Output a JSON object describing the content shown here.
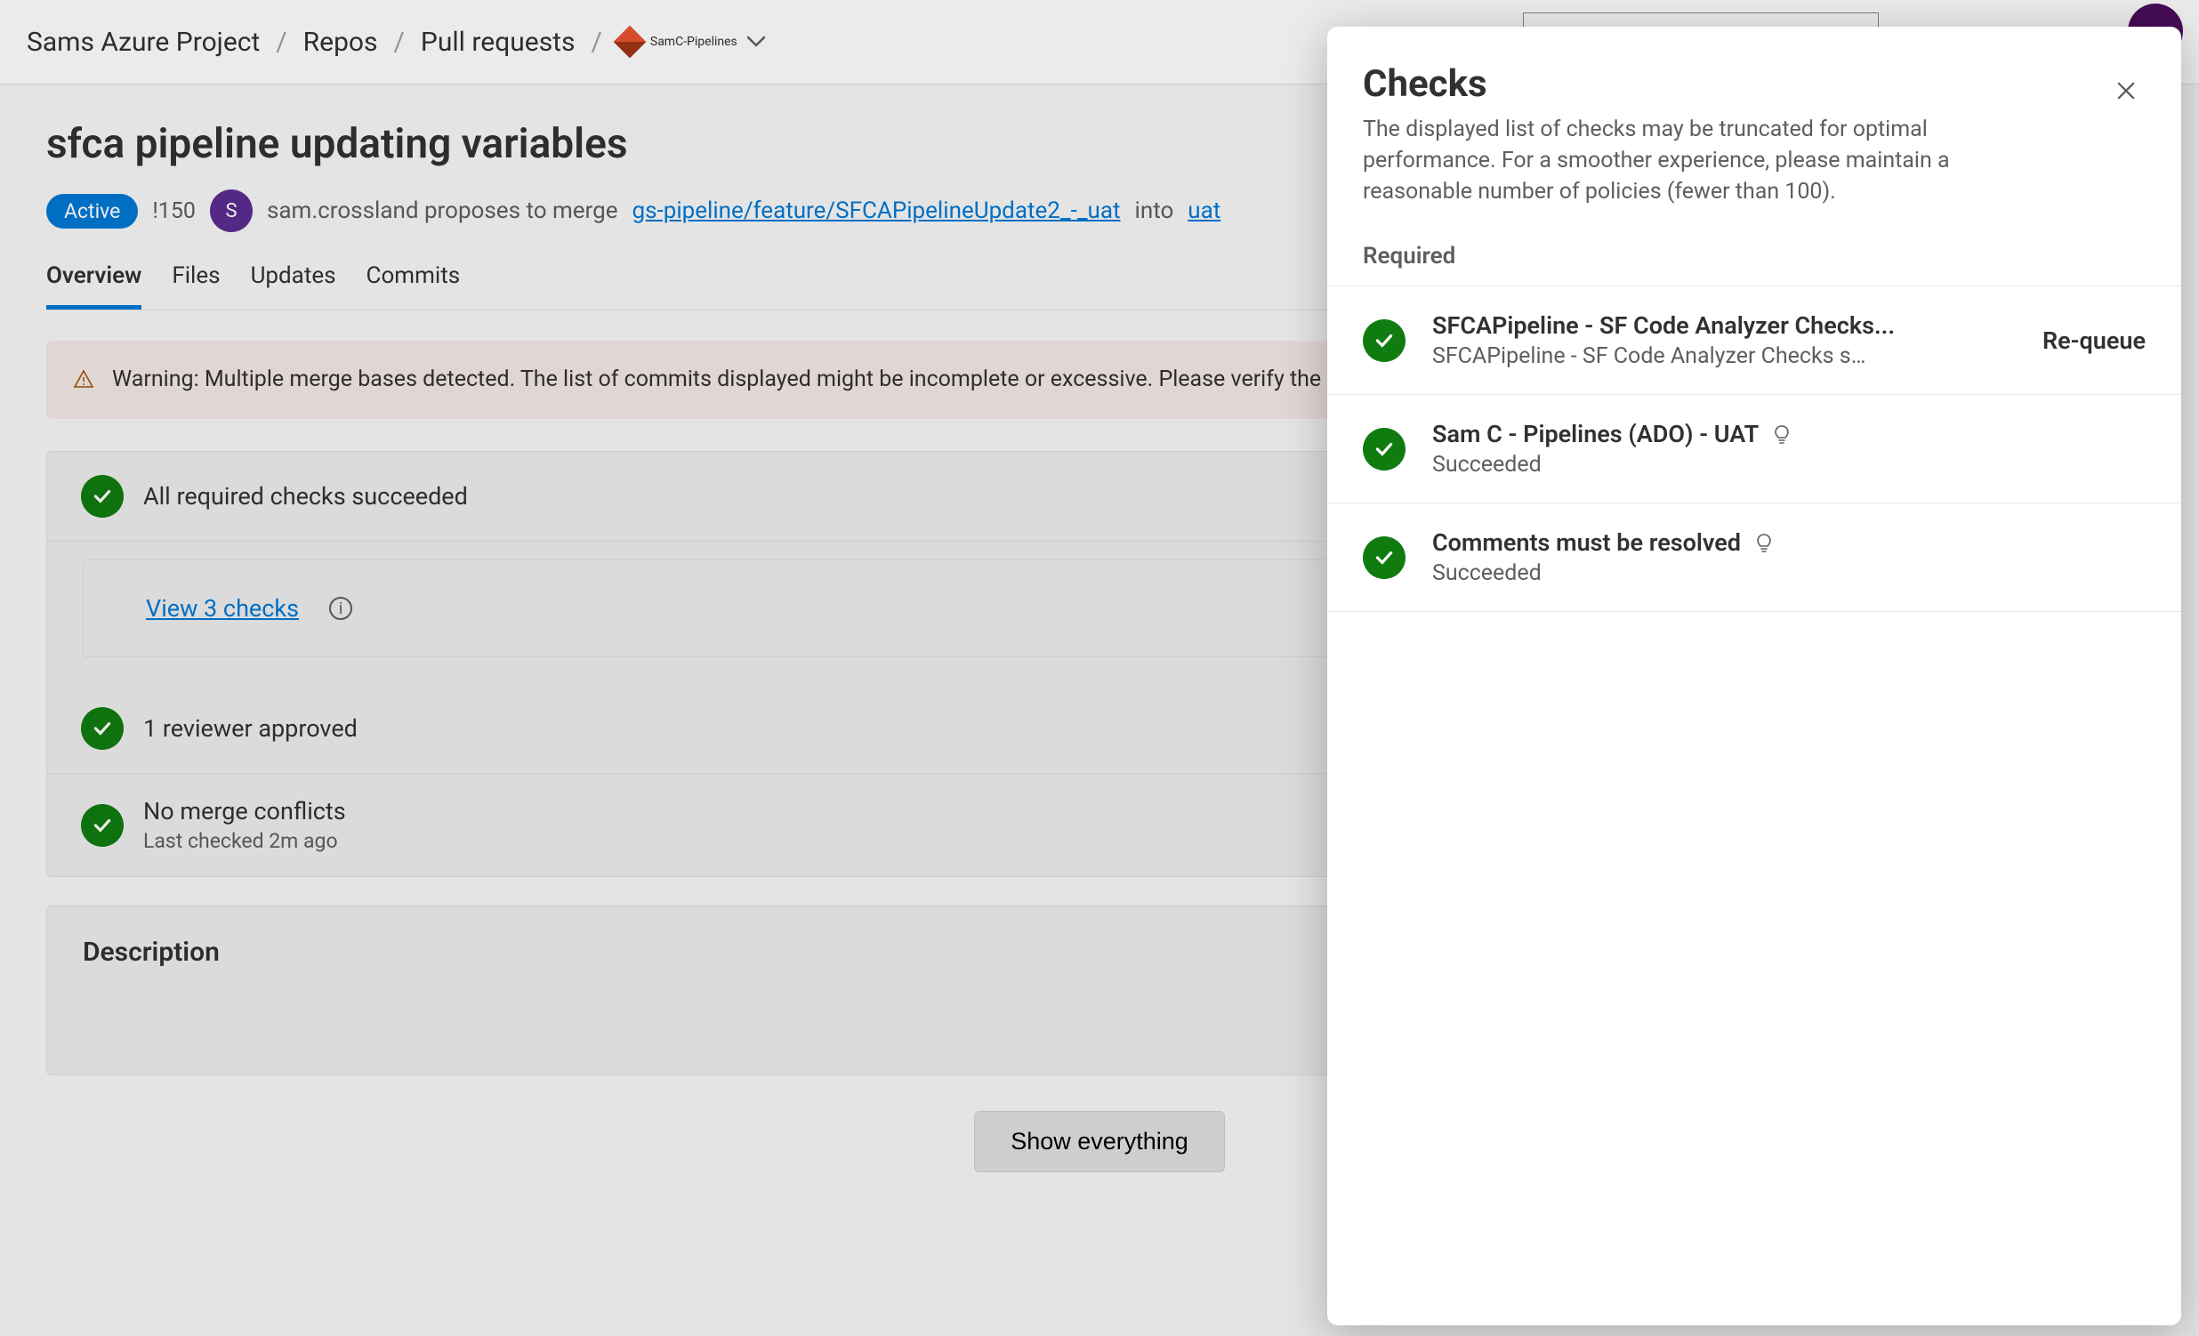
{
  "breadcrumbs": {
    "project": "Sams Azure Project",
    "repos": "Repos",
    "pull_requests": "Pull requests",
    "repo": "SamC-Pipelines"
  },
  "pr": {
    "title": "sfca pipeline updating variables",
    "status_badge": "Active",
    "id": "!150",
    "author_initial": "S",
    "author_text": "sam.crossland proposes to merge",
    "source_branch": "gs-pipeline/feature/SFCAPipelineUpdate2_-_uat",
    "into_text": "into",
    "target_branch": "uat"
  },
  "tabs": {
    "overview": "Overview",
    "files": "Files",
    "updates": "Updates",
    "commits": "Commits"
  },
  "warning": "Warning: Multiple merge bases detected. The list of commits displayed might be incomplete or excessive. Please verify the list of changes to be merged before merging this pull request.",
  "status": {
    "checks_succeeded": "All required checks succeeded",
    "view_checks": "View 3 checks",
    "reviewer_approved": "1 reviewer approved",
    "no_conflicts": "No merge conflicts",
    "last_checked": "Last checked 2m ago"
  },
  "description_heading": "Description",
  "show_everything": "Show everything",
  "panel": {
    "title": "Checks",
    "description": "The displayed list of checks may be truncated for optimal performance. For a smoother experience, please maintain a reasonable number of policies (fewer than 100).",
    "required_label": "Required",
    "requeue_label": "Re-queue",
    "checks": [
      {
        "title": "SFCAPipeline - SF Code Analyzer Checks...",
        "subtitle": "SFCAPipeline - SF Code Analyzer Checks s…",
        "has_bulb": false,
        "requeue": true
      },
      {
        "title": "Sam C - Pipelines (ADO) - UAT",
        "subtitle": "Succeeded",
        "has_bulb": true,
        "requeue": false
      },
      {
        "title": "Comments must be resolved",
        "subtitle": "Succeeded",
        "has_bulb": true,
        "requeue": false
      }
    ]
  }
}
